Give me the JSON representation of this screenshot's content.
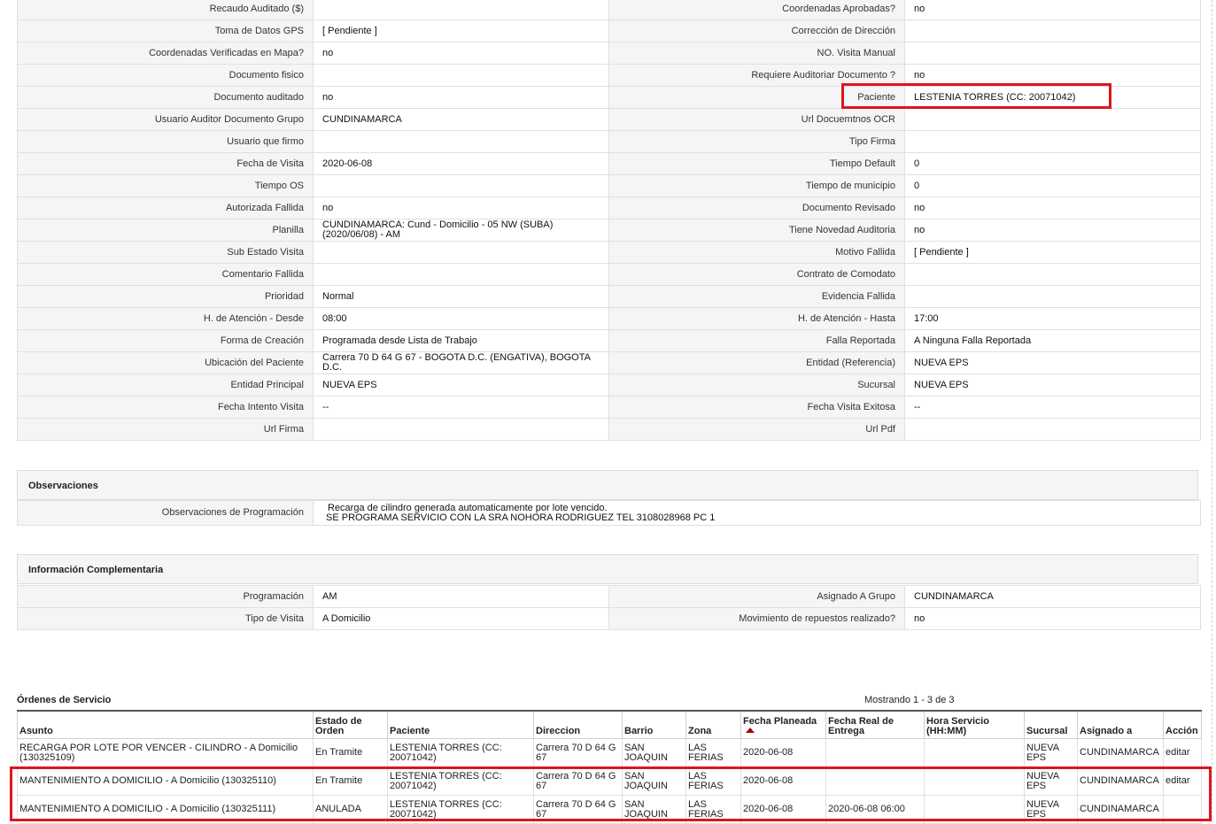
{
  "main_rows": [
    {
      "l1": "Recaudo Auditado ($)",
      "v1": "",
      "l2": "Coordenadas Aprobadas?",
      "v2": " no"
    },
    {
      "l1": "Toma de Datos GPS",
      "v1": "[ Pendiente ]",
      "l2": "Corrección de Dirección",
      "v2": ""
    },
    {
      "l1": "Coordenadas Verificadas en Mapa?",
      "v1": " no",
      "l2": "NO. Visita Manual",
      "v2": ""
    },
    {
      "l1": "Documento fisico",
      "v1": "",
      "l2": "Requiere Auditoriar Documento ?",
      "v2": " no"
    },
    {
      "l1": "Documento auditado",
      "v1": " no",
      "l2": "Paciente",
      "v2": "LESTENIA TORRES (CC: 20071042)"
    },
    {
      "l1": "Usuario Auditor Documento Grupo",
      "v1": "CUNDINAMARCA",
      "l2": "Url Docuemtnos OCR",
      "v2": ""
    },
    {
      "l1": "Usuario que firmo",
      "v1": "",
      "l2": "Tipo Firma",
      "v2": ""
    },
    {
      "l1": "Fecha de Visita",
      "v1": " 2020-06-08",
      "l2": "Tiempo Default",
      "v2": "0"
    },
    {
      "l1": "Tiempo OS",
      "v1": "",
      "l2": "Tiempo de municipio",
      "v2": "0"
    },
    {
      "l1": "Autorizada Fallida",
      "v1": " no",
      "l2": "Documento Revisado",
      "v2": " no"
    },
    {
      "l1": "Planilla",
      "v1": "CUNDINAMARCA: Cund - Domicilio - 05 NW (SUBA) (2020/06/08) - AM",
      "l2": "Tiene Novedad Auditoria",
      "v2": " no"
    },
    {
      "l1": "Sub Estado Visita",
      "v1": "",
      "l2": "Motivo Fallida",
      "v2": "[ Pendiente ]"
    },
    {
      "l1": "Comentario Fallida",
      "v1": "",
      "l2": "Contrato de Comodato",
      "v2": ""
    },
    {
      "l1": "Prioridad",
      "v1": "Normal",
      "l2": "Evidencia Fallida",
      "v2": ""
    },
    {
      "l1": "H. de Atención - Desde",
      "v1": "08:00",
      "l2": "H. de Atención - Hasta",
      "v2": "17:00"
    },
    {
      "l1": "Forma de Creación",
      "v1": "Programada desde Lista de Trabajo",
      "l2": "Falla Reportada",
      "v2": "A Ninguna Falla Reportada"
    },
    {
      "l1": "Ubicación del Paciente",
      "v1": "Carrera 70 D 64 G 67 - BOGOTA D.C. (ENGATIVA), BOGOTA D.C.",
      "l2": "Entidad (Referencia)",
      "v2": "NUEVA EPS"
    },
    {
      "l1": "Entidad Principal",
      "v1": "NUEVA EPS",
      "l2": "Sucursal",
      "v2": "NUEVA EPS"
    },
    {
      "l1": "Fecha Intento Visita",
      "v1": " --",
      "l2": "Fecha Visita Exitosa",
      "v2": " --"
    },
    {
      "l1": "Url Firma",
      "v1": "",
      "l2": "Url Pdf",
      "v2": ""
    }
  ],
  "observaciones": {
    "title": "Observaciones",
    "label": "Observaciones de Programación",
    "line1": " Recarga de cilindro generada automaticamente por lote vencido.",
    "line2": "SE PROGRAMA SERVICIO CON LA SRA NOHORA RODRIGUEZ TEL 3108028968 PC 1"
  },
  "complementaria": {
    "title": "Información Complementaria",
    "rows": [
      {
        "l1": "Programación",
        "v1": "AM",
        "l2": "Asignado A Grupo",
        "v2": "CUNDINAMARCA"
      },
      {
        "l1": "Tipo de Visita",
        "v1": "A Domicilio",
        "l2": "Movimiento de repuestos realizado?",
        "v2": " no"
      }
    ]
  },
  "orders": {
    "title": "Órdenes de Servicio",
    "count": "Mostrando 1 - 3 de 3",
    "columns": [
      "Asunto",
      "Estado de Orden",
      "Paciente",
      "Direccion",
      "Barrio",
      "Zona",
      "Fecha Planeada",
      "Fecha Real de Entrega",
      "Hora Servicio (HH:MM)",
      "Sucursal",
      "Asignado a",
      "Acción"
    ],
    "rows": [
      {
        "asunto": "RECARGA POR LOTE POR VENCER - CILINDRO - A Domicilio (130325109)",
        "estado": "En Tramite",
        "paciente": "LESTENIA TORRES (CC: 20071042)",
        "direccion": "Carrera 70 D 64 G 67",
        "barrio": "SAN JOAQUIN",
        "zona": "LAS FERIAS",
        "fecha_planeada": "2020-06-08",
        "fecha_real": "",
        "hora": "",
        "sucursal": "NUEVA EPS",
        "asignado": "CUNDINAMARCA",
        "accion": "editar"
      },
      {
        "asunto": "MANTENIMIENTO A DOMICILIO - A Domicilio (130325110)",
        "estado": "En Tramite",
        "paciente": "LESTENIA TORRES (CC: 20071042)",
        "direccion": "Carrera 70 D 64 G 67",
        "barrio": "SAN JOAQUIN",
        "zona": "LAS FERIAS",
        "fecha_planeada": "2020-06-08",
        "fecha_real": "",
        "hora": "",
        "sucursal": "NUEVA EPS",
        "asignado": "CUNDINAMARCA",
        "accion": "editar"
      },
      {
        "asunto": "MANTENIMIENTO A DOMICILIO - A Domicilio (130325111)",
        "estado": "ANULADA",
        "paciente": "LESTENIA TORRES (CC: 20071042)",
        "direccion": "Carrera 70 D 64 G 67",
        "barrio": "SAN JOAQUIN",
        "zona": "LAS FERIAS",
        "fecha_planeada": "2020-06-08",
        "fecha_real": "2020-06-08 06:00",
        "hora": "",
        "sucursal": "NUEVA EPS",
        "asignado": "CUNDINAMARCA",
        "accion": ""
      }
    ]
  },
  "colors": {
    "highlight": "#e0141e",
    "label_bg": "#f5f5f5",
    "sort_arrow": "#aa0000"
  }
}
